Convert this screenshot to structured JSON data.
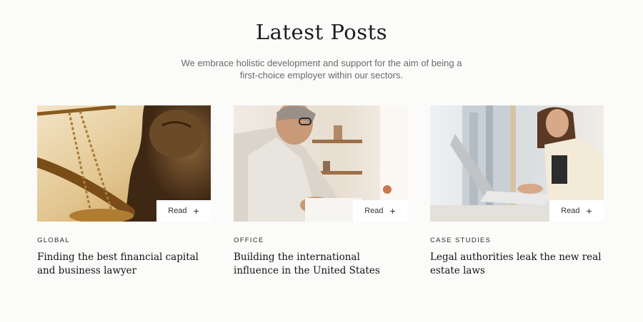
{
  "section": {
    "title": "Latest Posts",
    "subtitle": "We embrace holistic development and support for the aim of being a first-choice employer within our sectors."
  },
  "posts": [
    {
      "category": "GLOBAL",
      "title": "Finding the best financial capital and business lawyer",
      "read_label": "Read",
      "icon": "plus-icon"
    },
    {
      "category": "OFFICE",
      "title": "Building the international influence in the United States",
      "read_label": "Read",
      "icon": "plus-icon"
    },
    {
      "category": "CASE STUDIES",
      "title": "Legal authorities leak the new real estate laws",
      "read_label": "Read",
      "icon": "plus-icon"
    }
  ],
  "colors": {
    "background": "#fbfbfa",
    "text": "#1d1d1d",
    "muted": "#6a6a6a"
  }
}
